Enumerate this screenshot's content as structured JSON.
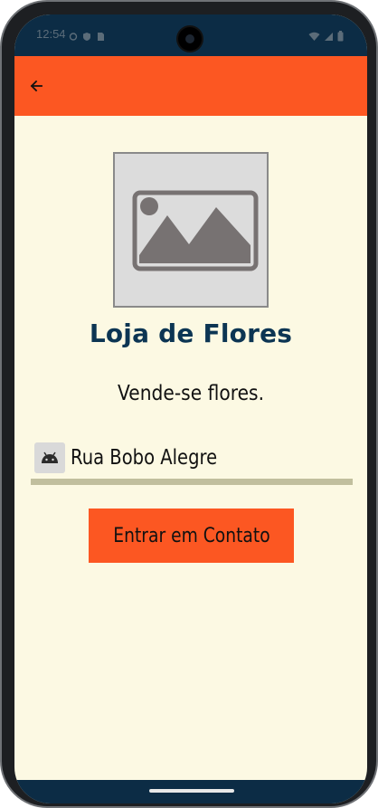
{
  "status_bar": {
    "time": "12:54",
    "left_icons": [
      "sync-icon",
      "shield-icon",
      "sim-icon"
    ],
    "right_icons": [
      "wifi-icon",
      "signal-icon",
      "battery-icon"
    ]
  },
  "app_bar": {
    "back_icon": "arrow-left-icon",
    "color": "#fc5722"
  },
  "store": {
    "image_placeholder_icon": "image-icon",
    "name": "Loja de Flores",
    "description": "Vende-se flores.",
    "address_icon": "android-icon",
    "address": "Rua Bobo Alegre"
  },
  "actions": {
    "contact_label": "Entrar em Contato"
  },
  "colors": {
    "accent": "#fc5722",
    "dark_blue": "#0c2c45",
    "background": "#fcf9e3",
    "title": "#0c3553"
  }
}
